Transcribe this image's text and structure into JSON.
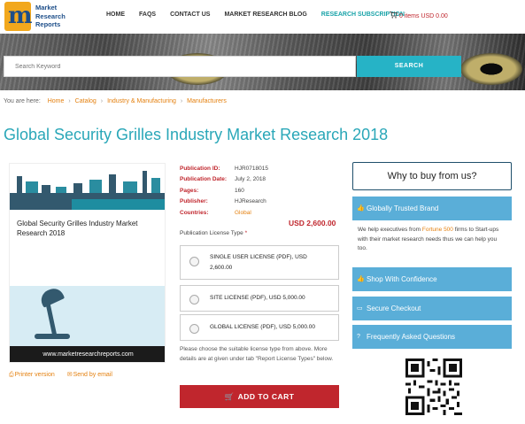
{
  "logo": {
    "text": "Market\nResearch\nReports",
    "mark": "m"
  },
  "nav": {
    "items": [
      {
        "label": "HOME"
      },
      {
        "label": "FAQS"
      },
      {
        "label": "CONTACT US"
      },
      {
        "label": "MARKET RESEARCH BLOG"
      },
      {
        "label": "RESEARCH SUBSCRIPTION"
      }
    ],
    "cart": "0 items USD 0.00",
    "cart_icon": "cart-icon"
  },
  "search": {
    "placeholder": "Search Keyword",
    "button": "SEARCH"
  },
  "breadcrumb": {
    "prefix": "You are here:",
    "items": [
      "Home",
      "Catalog",
      "Industry & Manufacturing",
      "Manufacturers"
    ]
  },
  "page_title": "Global Security Grilles Industry Market Research 2018",
  "product_image": {
    "title": "Global Security Grilles Industry Market Research 2018",
    "url": "www.marketresearchreports.com"
  },
  "image_links": {
    "printer": "Printer version",
    "email": "Send by email"
  },
  "meta": {
    "publication_id": {
      "label": "Publication ID:",
      "value": "HJR0718015"
    },
    "publication_date": {
      "label": "Publication Date:",
      "value": "July 2, 2018"
    },
    "pages": {
      "label": "Pages:",
      "value": "160"
    },
    "publisher": {
      "label": "Publisher:",
      "value": "HJResearch"
    },
    "countries": {
      "label": "Countries:",
      "value": "Global"
    }
  },
  "price": "USD 2,600.00",
  "license": {
    "label": "Publication License Type",
    "required": "*",
    "options": [
      {
        "label": "SINGLE USER LICENSE (PDF), USD 2,600.00"
      },
      {
        "label": "SITE LICENSE (PDF), USD 5,000.00"
      },
      {
        "label": "GLOBAL LICENSE (PDF), USD 5,000.00"
      }
    ]
  },
  "note": "Please choose the suitable license type from above. More details are at given under tab \"Report License Types\" below.",
  "add_to_cart": "ADD TO CART",
  "sidebar": {
    "why": "Why to buy from us?",
    "trusted": "Globally Trusted Brand",
    "trusted_text_1": "We help executives from ",
    "trusted_highlight": "Fortune 500",
    "trusted_text_2": " firms to Start-ups with their market research needs thus we can help you too.",
    "shop": "Shop With Confidence",
    "checkout": "Secure Checkout",
    "faq": "Frequently Asked Questions"
  },
  "colors": {
    "accent_teal": "#2aa7b8",
    "brand_red": "#c0262d",
    "orange_link": "#e4800f",
    "sidebar_blue": "#5aaed8"
  }
}
